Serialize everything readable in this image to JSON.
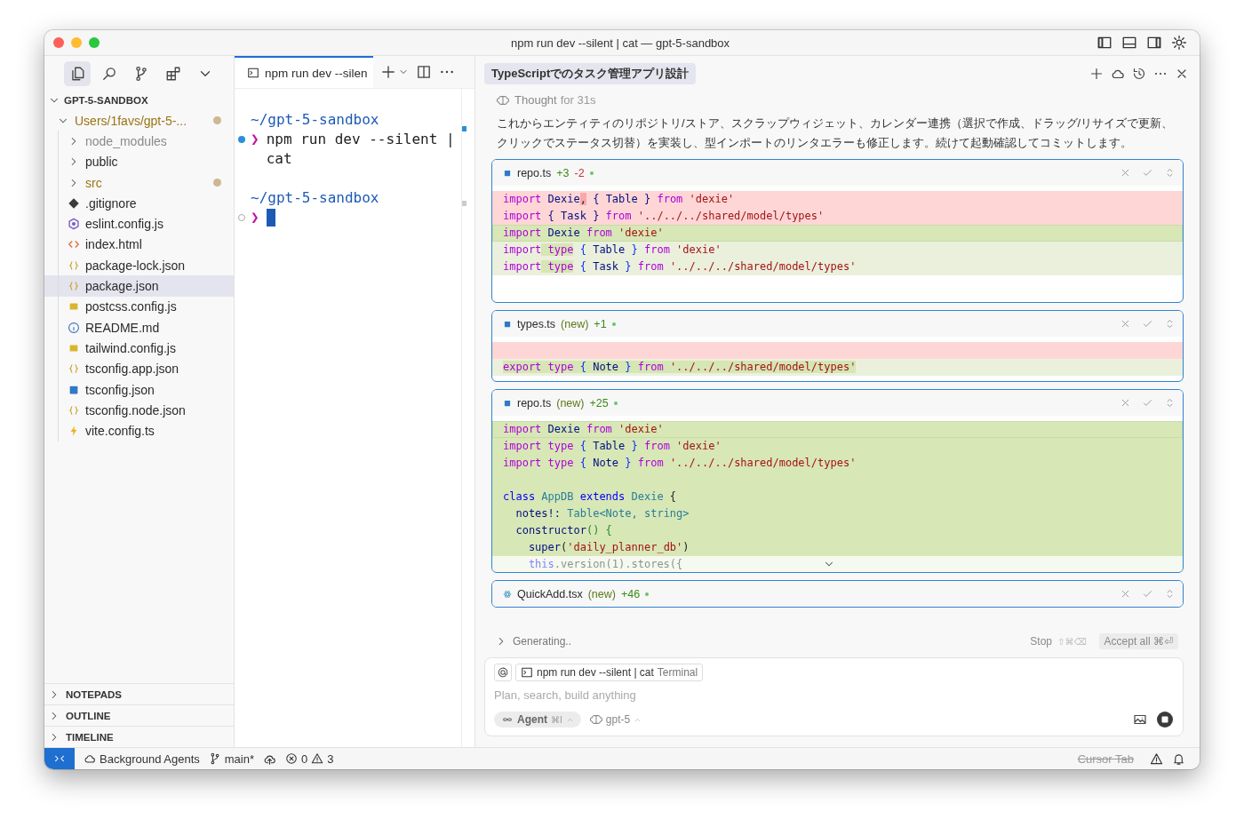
{
  "window": {
    "title": "npm run dev --silent | cat — gpt-5-sandbox"
  },
  "activity_bar": [
    {
      "kind": "files",
      "selected": true
    },
    {
      "kind": "search",
      "selected": false
    },
    {
      "kind": "branch",
      "selected": false
    },
    {
      "kind": "extensions",
      "selected": false
    },
    {
      "kind": "chevron-down",
      "selected": false
    }
  ],
  "explorer": {
    "title": "GPT-5-SANDBOX",
    "expanded": true,
    "tree": [
      {
        "name": "Users/1favs/gpt-5-...",
        "kind": "folder",
        "expanded": true,
        "modified": true,
        "ignored": false,
        "selected": false,
        "children": [
          {
            "name": "node_modules",
            "kind": "folder",
            "expanded": false,
            "modified": false,
            "ignored": true,
            "selected": false
          },
          {
            "name": "public",
            "kind": "folder",
            "expanded": false,
            "modified": false,
            "ignored": false,
            "selected": false
          },
          {
            "name": "src",
            "kind": "folder",
            "expanded": false,
            "modified": true,
            "ignored": false,
            "selected": false
          },
          {
            "name": ".gitignore",
            "kind": "git",
            "modified": false,
            "ignored": false,
            "selected": false
          },
          {
            "name": "eslint.config.js",
            "kind": "eslint",
            "modified": false,
            "ignored": false,
            "selected": false
          },
          {
            "name": "index.html",
            "kind": "html",
            "modified": false,
            "ignored": false,
            "selected": false
          },
          {
            "name": "package-lock.json",
            "kind": "json",
            "modified": false,
            "ignored": false,
            "selected": false
          },
          {
            "name": "package.json",
            "kind": "json",
            "modified": false,
            "ignored": false,
            "selected": true
          },
          {
            "name": "postcss.config.js",
            "kind": "js",
            "modified": false,
            "ignored": false,
            "selected": false
          },
          {
            "name": "README.md",
            "kind": "info",
            "modified": false,
            "ignored": false,
            "selected": false
          },
          {
            "name": "tailwind.config.js",
            "kind": "js",
            "modified": false,
            "ignored": false,
            "selected": false
          },
          {
            "name": "tsconfig.app.json",
            "kind": "json",
            "modified": false,
            "ignored": false,
            "selected": false
          },
          {
            "name": "tsconfig.json",
            "kind": "ts",
            "modified": false,
            "ignored": false,
            "selected": false
          },
          {
            "name": "tsconfig.node.json",
            "kind": "json",
            "modified": false,
            "ignored": false,
            "selected": false
          },
          {
            "name": "vite.config.ts",
            "kind": "vite",
            "modified": false,
            "ignored": false,
            "selected": false
          }
        ]
      }
    ]
  },
  "sections": [
    {
      "title": "NOTEPADS",
      "expanded": false
    },
    {
      "title": "OUTLINE",
      "expanded": false
    },
    {
      "title": "TIMELINE",
      "expanded": false
    }
  ],
  "terminal": {
    "tab": "npm run dev --silen",
    "blocks": [
      {
        "cwd": "~/gpt-5-sandbox",
        "running": false,
        "prompt": "❯",
        "command": "npm run dev --silent | cat"
      },
      {
        "cwd": "~/gpt-5-sandbox",
        "running": true,
        "prompt": "❯"
      }
    ]
  },
  "chat": {
    "title": "TypeScriptでのタスク管理アプリ設計",
    "thought": {
      "label": "Thought",
      "duration": "for 31s"
    },
    "message": "これからエンティティのリポジトリ/ストア、スクラップウィジェット、カレンダー連携（選択で作成、ドラッグ/リサイズで更新、クリックでステータス切替）を実装し、型インポートのリンタエラーも修正します。続けて起動確認してコミットします。",
    "diffs": [
      {
        "file": "repo.ts",
        "kind": "ts",
        "added": "+3",
        "removed": "-2",
        "lines": [
          {
            "kind": "removed",
            "tokens": [
              {
                "t": "import",
                "kind": "kw",
                "hl": false
              },
              {
                "t": " Dexie",
                "kind": "id",
                "hl": false
              },
              {
                "t": ",",
                "kind": "plain",
                "hl": true
              },
              {
                "t": " { Table } ",
                "kind": "id",
                "hl": false
              },
              {
                "t": "from",
                "kind": "kw",
                "hl": false
              },
              {
                "t": " 'dexie'",
                "kind": "str",
                "hl": false
              }
            ]
          },
          {
            "kind": "removed",
            "tokens": [
              {
                "t": "import",
                "kind": "kw",
                "hl": false
              },
              {
                "t": " { Task } ",
                "kind": "id",
                "hl": false
              },
              {
                "t": "from",
                "kind": "kw",
                "hl": false
              },
              {
                "t": " '../../../shared/model/types'",
                "kind": "str",
                "hl": false
              }
            ]
          },
          {
            "kind": "added-strong",
            "tokens": [
              {
                "t": "import",
                "kind": "kw",
                "hl": false
              },
              {
                "t": " Dexie ",
                "kind": "id",
                "hl": false
              },
              {
                "t": "from",
                "kind": "kw",
                "hl": false
              },
              {
                "t": " 'dexie'",
                "kind": "str",
                "hl": false
              }
            ]
          },
          {
            "kind": "added",
            "tokens": [
              {
                "t": "import",
                "kind": "kw",
                "hl": false
              },
              {
                "t": " type",
                "kind": "kw",
                "hl": true
              },
              {
                "t": " {",
                "kind": "punct",
                "hl": false
              },
              {
                "t": " Table ",
                "kind": "id",
                "hl": false
              },
              {
                "t": "} ",
                "kind": "punct",
                "hl": false
              },
              {
                "t": "from",
                "kind": "kw",
                "hl": false
              },
              {
                "t": " 'dexie'",
                "kind": "str",
                "hl": false
              }
            ]
          },
          {
            "kind": "added",
            "tokens": [
              {
                "t": "import",
                "kind": "kw",
                "hl": false
              },
              {
                "t": " type",
                "kind": "kw",
                "hl": true
              },
              {
                "t": " {",
                "kind": "punct",
                "hl": false
              },
              {
                "t": " Task ",
                "kind": "id",
                "hl": false
              },
              {
                "t": "} ",
                "kind": "punct",
                "hl": false
              },
              {
                "t": "from",
                "kind": "kw",
                "hl": false
              },
              {
                "t": " '../../../shared/model/types'",
                "kind": "str",
                "hl": false
              }
            ]
          }
        ]
      },
      {
        "file": "types.ts",
        "kind": "ts",
        "tag": "(new)",
        "added": "+1",
        "lines": [
          {
            "kind": "removed"
          },
          {
            "kind": "added",
            "tokens": [
              {
                "t": "export",
                "kind": "kw",
                "hl": true
              },
              {
                "t": " type",
                "kind": "kw",
                "hl": true
              },
              {
                "t": " {",
                "kind": "punct",
                "hl": true
              },
              {
                "t": " Note ",
                "kind": "id",
                "hl": true
              },
              {
                "t": "} ",
                "kind": "punct",
                "hl": true
              },
              {
                "t": "from",
                "kind": "kw",
                "hl": true
              },
              {
                "t": " '../../../shared/model/types'",
                "kind": "str",
                "hl": true
              }
            ]
          }
        ]
      },
      {
        "file": "repo.ts",
        "kind": "ts",
        "tag": "(new)",
        "added": "+25",
        "lines": [
          {
            "kind": "added-strong",
            "tokens": [
              {
                "t": "import",
                "kind": "kw",
                "hl": false
              },
              {
                "t": " Dexie ",
                "kind": "id",
                "hl": false
              },
              {
                "t": "from",
                "kind": "kw",
                "hl": false
              },
              {
                "t": " 'dexie'",
                "kind": "str",
                "hl": false
              }
            ]
          },
          {
            "kind": "new",
            "tokens": [
              {
                "t": "import",
                "kind": "kw",
                "hl": false
              },
              {
                "t": " type",
                "kind": "kw",
                "hl": false
              },
              {
                "t": " {",
                "kind": "punct",
                "hl": false
              },
              {
                "t": " Table ",
                "kind": "id",
                "hl": false
              },
              {
                "t": "} ",
                "kind": "punct",
                "hl": false
              },
              {
                "t": "from",
                "kind": "kw",
                "hl": false
              },
              {
                "t": " 'dexie'",
                "kind": "str",
                "hl": false
              }
            ]
          },
          {
            "kind": "new",
            "tokens": [
              {
                "t": "import",
                "kind": "kw",
                "hl": false
              },
              {
                "t": " type",
                "kind": "kw",
                "hl": false
              },
              {
                "t": " {",
                "kind": "punct",
                "hl": false
              },
              {
                "t": " Note ",
                "kind": "id",
                "hl": false
              },
              {
                "t": "} ",
                "kind": "punct",
                "hl": false
              },
              {
                "t": "from",
                "kind": "kw",
                "hl": false
              },
              {
                "t": " '../../../shared/model/types'",
                "kind": "str",
                "hl": false
              }
            ]
          },
          {
            "kind": "new"
          },
          {
            "kind": "new",
            "tokens": [
              {
                "t": "class",
                "kind": "decl",
                "hl": false
              },
              {
                "t": " AppDB",
                "kind": "type",
                "hl": false
              },
              {
                "t": " extends",
                "kind": "decl",
                "hl": false
              },
              {
                "t": " Dexie",
                "kind": "type",
                "hl": false
              },
              {
                "t": " {",
                "kind": "plain",
                "hl": false
              }
            ]
          },
          {
            "kind": "new",
            "tokens": [
              {
                "t": "  notes!:",
                "kind": "id",
                "hl": false
              },
              {
                "t": " Table<Note, string>",
                "kind": "type",
                "hl": false
              }
            ]
          },
          {
            "kind": "new",
            "tokens": [
              {
                "t": "  constructor",
                "kind": "id",
                "hl": false
              },
              {
                "t": "() {",
                "kind": "fn",
                "hl": false
              }
            ]
          },
          {
            "kind": "new",
            "tokens": [
              {
                "t": "    super",
                "kind": "id",
                "hl": false
              },
              {
                "t": "(",
                "kind": "plain",
                "hl": false
              },
              {
                "t": "'daily_planner_db'",
                "kind": "str",
                "hl": false
              },
              {
                "t": ")",
                "kind": "plain",
                "hl": false
              }
            ]
          },
          {
            "kind": "faded",
            "tokens": [
              {
                "t": "    this",
                "kind": "decl",
                "hl": false
              },
              {
                "t": ".version(1).stores({",
                "kind": "plain",
                "hl": false
              }
            ]
          }
        ]
      },
      {
        "file": "QuickAdd.tsx",
        "kind": "react",
        "tag": "(new)",
        "added": "+46"
      }
    ],
    "generating": {
      "label": "Generating..",
      "stop": "Stop",
      "stop_keys": "⇧⌘⌫",
      "accept": "Accept all",
      "accept_keys": "⌘⏎"
    },
    "composer": {
      "context": {
        "label": "npm run dev --silent | cat",
        "type": "Terminal"
      },
      "placeholder": "Plan, search, build anything",
      "mode": "Agent",
      "mode_keys": "⌘I",
      "model": "gpt-5"
    }
  },
  "status_bar": {
    "agents": "Background Agents",
    "branch": "main*",
    "errors": "0",
    "warnings": "3",
    "cursor_tab": "Cursor Tab"
  }
}
